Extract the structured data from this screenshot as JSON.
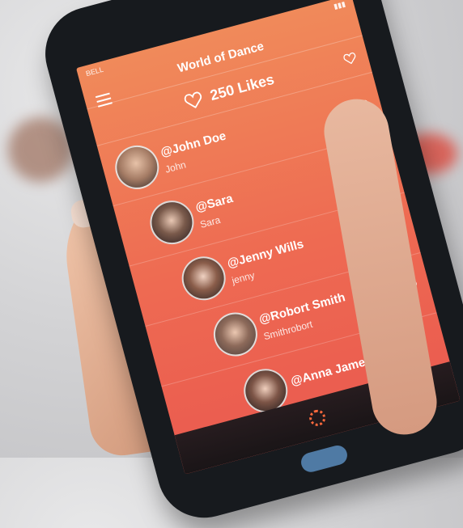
{
  "status_bar": {
    "carrier": "BELL",
    "time": ""
  },
  "header": {
    "title": "World of Dance"
  },
  "likes": {
    "count_label": "250 Likes"
  },
  "users": [
    {
      "handle": "@John Doe",
      "name": "John"
    },
    {
      "handle": "@Sara",
      "name": "Sara"
    },
    {
      "handle": "@Jenny Wills",
      "name": "jenny"
    },
    {
      "handle": "@Robort Smith",
      "name": "Smithrobort"
    },
    {
      "handle": "@Anna James",
      "name": ""
    }
  ],
  "colors": {
    "accent": "#ee6a52",
    "accent_light": "#f08a5a",
    "bottom_bar": "#1a1517",
    "spinner": "#ff6a3d"
  },
  "icons": {
    "menu": "hamburger-icon",
    "like": "heart-icon",
    "loading": "spinner-icon"
  }
}
